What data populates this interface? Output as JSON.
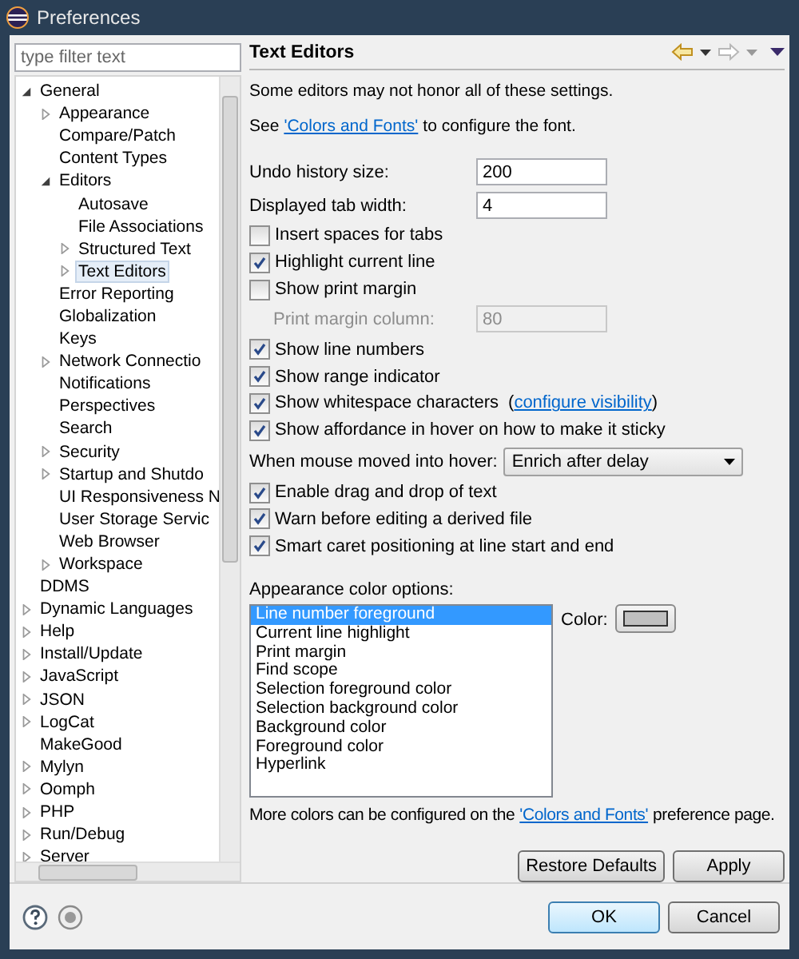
{
  "window": {
    "title": "Preferences"
  },
  "filter": {
    "placeholder": "type filter text"
  },
  "tree": [
    {
      "label": "General",
      "expanded": true,
      "selected": false,
      "children": [
        {
          "label": "Appearance",
          "expanded": false,
          "selected": false
        },
        {
          "label": "Compare/Patch",
          "selected": false
        },
        {
          "label": "Content Types",
          "selected": false
        },
        {
          "label": "Editors",
          "expanded": true,
          "selected": false,
          "children": [
            {
              "label": "Autosave",
              "selected": false
            },
            {
              "label": "File Associations",
              "selected": false
            },
            {
              "label": "Structured Text",
              "expanded": false,
              "selected": false
            },
            {
              "label": "Text Editors",
              "expanded": false,
              "selected": true
            }
          ]
        },
        {
          "label": "Error Reporting",
          "selected": false
        },
        {
          "label": "Globalization",
          "selected": false
        },
        {
          "label": "Keys",
          "selected": false
        },
        {
          "label": "Network Connectio",
          "expanded": false,
          "selected": false
        },
        {
          "label": "Notifications",
          "selected": false
        },
        {
          "label": "Perspectives",
          "selected": false
        },
        {
          "label": "Search",
          "selected": false
        },
        {
          "label": "Security",
          "expanded": false,
          "selected": false
        },
        {
          "label": "Startup and Shutdo",
          "expanded": false,
          "selected": false
        },
        {
          "label": "UI Responsiveness N",
          "selected": false
        },
        {
          "label": "User Storage Servic",
          "selected": false
        },
        {
          "label": "Web Browser",
          "selected": false
        },
        {
          "label": "Workspace",
          "expanded": false,
          "selected": false
        }
      ]
    },
    {
      "label": "DDMS",
      "selected": false
    },
    {
      "label": "Dynamic Languages",
      "expanded": false,
      "selected": false
    },
    {
      "label": "Help",
      "expanded": false,
      "selected": false
    },
    {
      "label": "Install/Update",
      "expanded": false,
      "selected": false
    },
    {
      "label": "JavaScript",
      "expanded": false,
      "selected": false
    },
    {
      "label": "JSON",
      "expanded": false,
      "selected": false
    },
    {
      "label": "LogCat",
      "expanded": false,
      "selected": false
    },
    {
      "label": "MakeGood",
      "selected": false
    },
    {
      "label": "Mylyn",
      "expanded": false,
      "selected": false
    },
    {
      "label": "Oomph",
      "expanded": false,
      "selected": false
    },
    {
      "label": "PHP",
      "expanded": false,
      "selected": false
    },
    {
      "label": "Run/Debug",
      "expanded": false,
      "selected": false
    },
    {
      "label": "Server",
      "expanded": false,
      "selected": false
    }
  ],
  "page": {
    "title": "Text Editors",
    "note": "Some editors may not honor all of these settings.",
    "see": {
      "before": "See",
      "link": "'Colors and Fonts'",
      "after": "to configure the font."
    },
    "settings": [
      {
        "kind": "field",
        "label": "Undo history size:",
        "value": "200",
        "disabled": false,
        "indent": false
      },
      {
        "kind": "field",
        "label": "Displayed tab width:",
        "value": "4",
        "disabled": false,
        "indent": false
      },
      {
        "kind": "checkbox",
        "label": "Insert spaces for tabs",
        "checked": false
      },
      {
        "kind": "checkbox",
        "label": "Highlight current line",
        "checked": true
      },
      {
        "kind": "checkbox",
        "label": "Show print margin",
        "checked": false
      },
      {
        "kind": "field",
        "label": "Print margin column:",
        "value": "80",
        "disabled": true,
        "indent": true
      },
      {
        "kind": "checkbox",
        "label": "Show line numbers",
        "checked": true
      },
      {
        "kind": "checkbox",
        "label": "Show range indicator",
        "checked": true
      },
      {
        "kind": "checkbox",
        "label": "Show whitespace characters",
        "checked": true,
        "link_open": "(",
        "link": "configure visibility",
        "link_close": ")"
      },
      {
        "kind": "checkbox",
        "label": "Show affordance in hover on how to make it sticky",
        "checked": true
      },
      {
        "kind": "select",
        "label": "When mouse moved into hover:",
        "value": "Enrich after delay"
      },
      {
        "kind": "checkbox",
        "label": "Enable drag and drop of text",
        "checked": true
      },
      {
        "kind": "checkbox",
        "label": "Warn before editing a derived file",
        "checked": true
      },
      {
        "kind": "checkbox",
        "label": "Smart caret positioning at line start and end",
        "checked": true
      }
    ],
    "color_options": {
      "label": "Appearance color options:",
      "items": [
        {
          "label": "Line number foreground",
          "selected": true
        },
        {
          "label": "Current line highlight",
          "selected": false
        },
        {
          "label": "Print margin",
          "selected": false
        },
        {
          "label": "Find scope",
          "selected": false
        },
        {
          "label": "Selection foreground color",
          "selected": false
        },
        {
          "label": "Selection background color",
          "selected": false
        },
        {
          "label": "Background color",
          "selected": false
        },
        {
          "label": "Foreground color",
          "selected": false
        },
        {
          "label": "Hyperlink",
          "selected": false
        }
      ],
      "color_label": "Color:",
      "color": "#c0c0c0"
    },
    "more": {
      "before": "More colors can be configured on the",
      "link": "'Colors and Fonts'",
      "after": "preference page."
    },
    "buttons": [
      "Restore Defaults",
      "Apply"
    ]
  },
  "footer_buttons": [
    "OK",
    "Cancel"
  ]
}
